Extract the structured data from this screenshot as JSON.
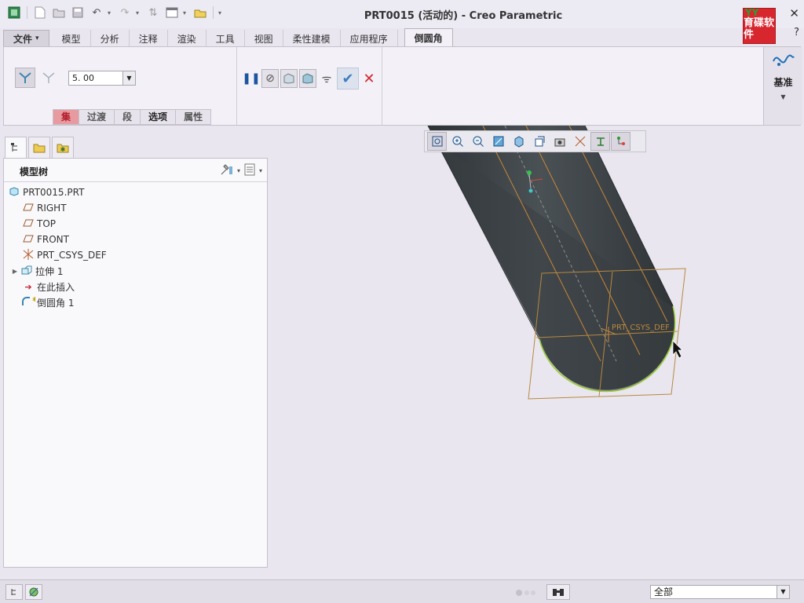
{
  "window": {
    "title": "PRT0015 (活动的) - Creo Parametric",
    "logo_text": "育碟软件",
    "logo_mark": "YY"
  },
  "ribbon": {
    "tabs": [
      {
        "label": "文件"
      },
      {
        "label": "模型"
      },
      {
        "label": "分析"
      },
      {
        "label": "注释"
      },
      {
        "label": "渲染"
      },
      {
        "label": "工具"
      },
      {
        "label": "视图"
      },
      {
        "label": "柔性建模"
      },
      {
        "label": "应用程序"
      },
      {
        "label": "倒圆角"
      }
    ],
    "file_dropdown_glyph": "▾",
    "radius_value": "5. 00",
    "subtabs": [
      {
        "label": "集"
      },
      {
        "label": "过渡"
      },
      {
        "label": "段"
      },
      {
        "label": "选项"
      },
      {
        "label": "属性"
      }
    ],
    "datum_label": "基准",
    "icons": {
      "set_mode": "set-mode-icon",
      "transition_mode": "transition-mode-icon",
      "pause": "pause-icon",
      "no_preview": "no-preview-icon",
      "preview": "preview-icon",
      "verify": "glasses-icon",
      "ok": "checkmark-icon",
      "cancel": "close-icon",
      "datum": "datum-icon"
    }
  },
  "model_tree": {
    "title": "模型树",
    "items": [
      {
        "label": "PRT0015.PRT",
        "icon": "part-icon"
      },
      {
        "label": "RIGHT",
        "icon": "datum-plane-icon"
      },
      {
        "label": "TOP",
        "icon": "datum-plane-icon"
      },
      {
        "label": "FRONT",
        "icon": "datum-plane-icon"
      },
      {
        "label": "PRT_CSYS_DEF",
        "icon": "csys-icon"
      },
      {
        "label": "拉伸 1",
        "icon": "extrude-icon"
      },
      {
        "label": "在此插入",
        "icon": "insert-arrow-icon"
      },
      {
        "label": "倒圆角 1",
        "icon": "round-icon"
      }
    ]
  },
  "graphics": {
    "csys_label": "PRT_CSYS_DEF",
    "colors": {
      "body": "#3f4548",
      "edge": "#c8873a",
      "preview": "#b8893f",
      "highlight_edge": "#9acd32"
    }
  },
  "statusbar": {
    "filter_value": "全部"
  },
  "colors": {
    "accent_red": "#d4252e",
    "accent_blue": "#1d6fb7",
    "background": "#e9e6ef"
  }
}
